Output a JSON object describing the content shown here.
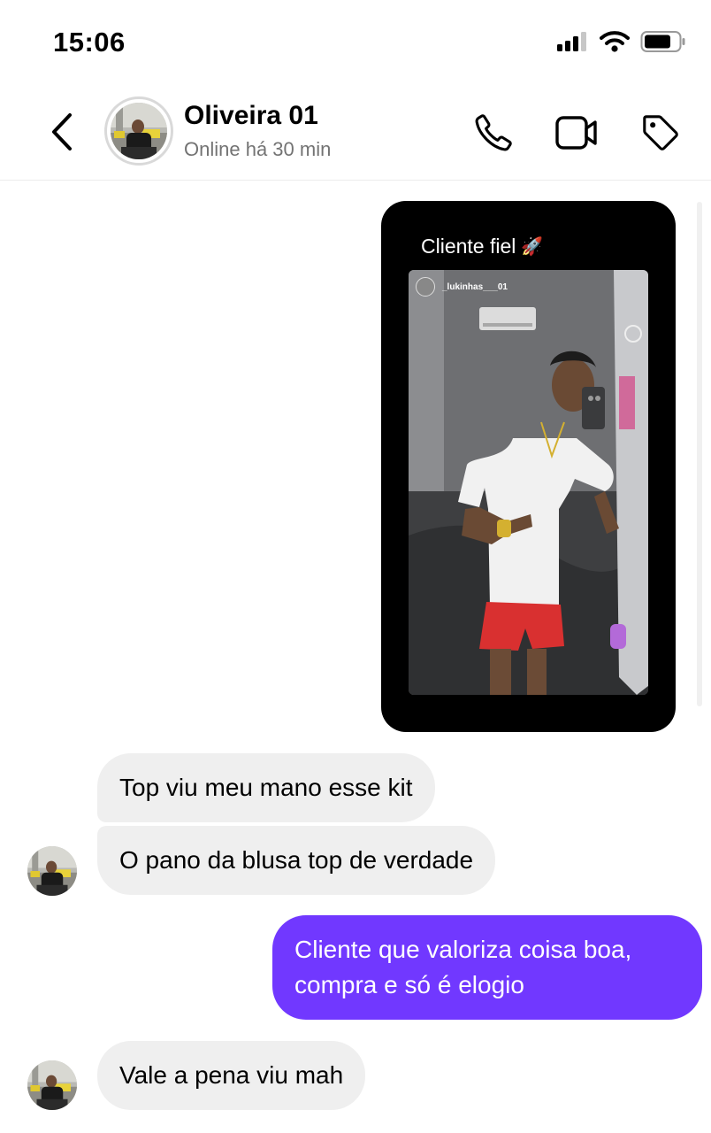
{
  "status_bar": {
    "time": "15:06"
  },
  "header": {
    "contact_name": "Oliveira 01",
    "contact_status": "Online há 30 min"
  },
  "icons": {
    "back": "chevron-left-icon",
    "call": "phone-icon",
    "video": "video-camera-icon",
    "tag": "tag-icon"
  },
  "shared_story": {
    "caption": "Cliente fiel",
    "caption_emoji": "🚀",
    "username": "_lukinhas___01"
  },
  "messages": [
    {
      "direction": "incoming",
      "text": "Top viu meu mano esse kit"
    },
    {
      "direction": "incoming",
      "text": "O pano da blusa top de verdade"
    },
    {
      "direction": "outgoing",
      "text": "Cliente que valoriza coisa boa, compra e só é elogio"
    },
    {
      "direction": "incoming",
      "text": "Vale a pena viu mah"
    }
  ],
  "colors": {
    "outgoing_bubble": "#7138ff",
    "incoming_bubble": "#efefef",
    "secondary_text": "#737373"
  }
}
